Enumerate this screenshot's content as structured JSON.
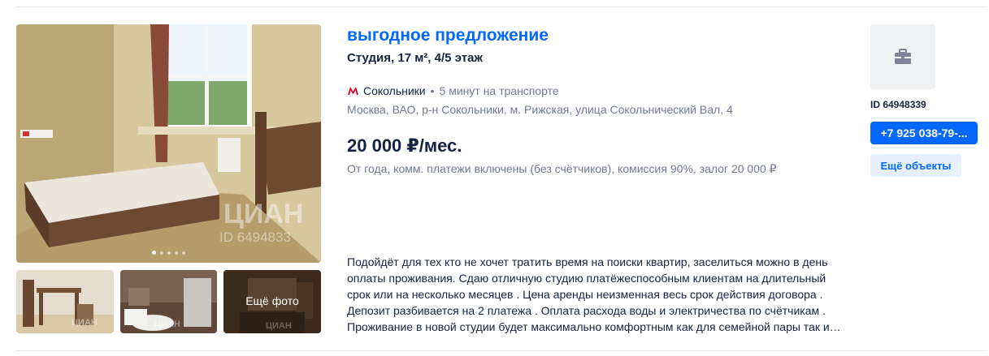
{
  "listing": {
    "title": "выгодное предложение",
    "subtitle": "Студия, 17 м², 4/5 этаж",
    "metro": {
      "icon": "metro-icon",
      "color": "#e4002b",
      "station": "Сокольники",
      "separator": "•",
      "time": "5 минут на транспорте"
    },
    "address": "Москва, ВАО, р-н Сокольники, м. Рижская, улица Сокольнический Вал, 4",
    "price": "20 000 ₽/мес.",
    "terms": "От года, комм. платежи включены (без счётчиков), комиссия 90%, залог 20 000 ₽",
    "description": "Подойдёт для тех кто не хочет тратить время на поиски квартир, заселиться можно в день оплаты проживания. Сдаю отличную студию платёжеспособным клиентам на длительный срок или на несколько месяцев . Цена аренды неизменная весь срок действия договора . Депозит разбивается на 2 платежа . Оплата расхода воды и электричества по счётчикам . Проживание в новой студии будет максимально комфортным как для семейной пары так и…"
  },
  "gallery": {
    "watermark": "ЦИАН",
    "watermark_id": "ID 6494833",
    "dots_total": 5,
    "dots_active": 1,
    "more_photos_label": "Ещё фото"
  },
  "agency": {
    "logo_icon": "briefcase-icon",
    "id_label": "ID 64948339",
    "phone": "+7 925 038-79-...",
    "more_objects": "Ещё объекты"
  },
  "colors": {
    "accent": "#0468ff",
    "accent_light": "#e6f0ff",
    "text_primary": "#152242",
    "text_secondary": "#737a8e"
  }
}
